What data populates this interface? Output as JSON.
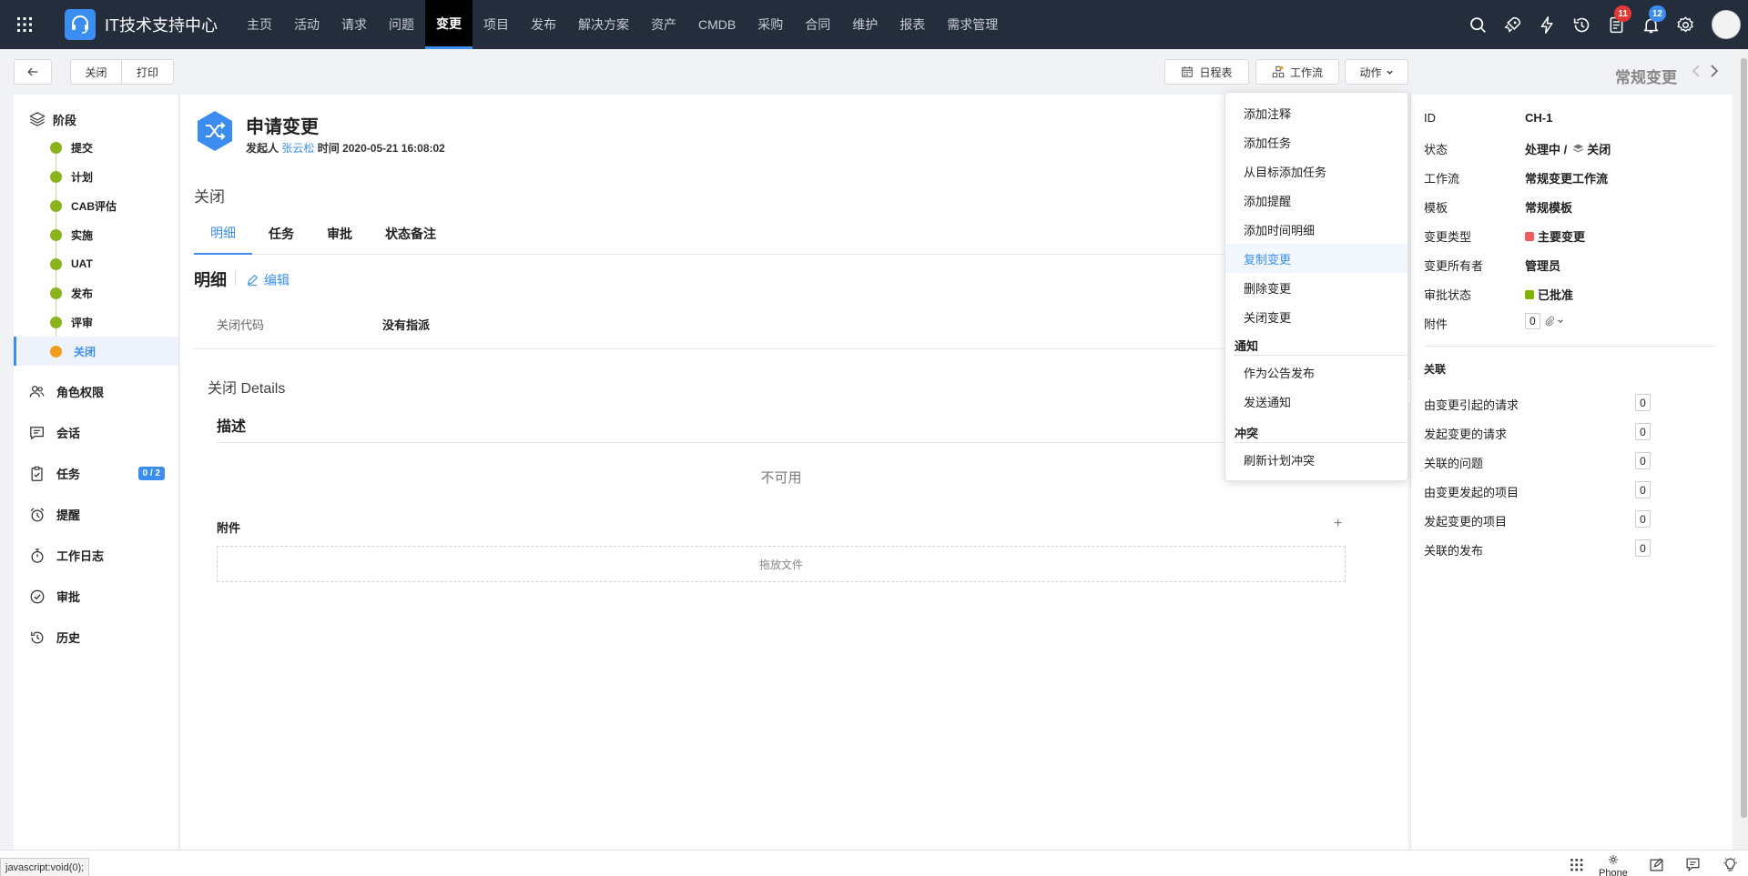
{
  "app": {
    "title": "IT技术支持中心"
  },
  "nav": {
    "items": [
      "主页",
      "活动",
      "请求",
      "问题",
      "变更",
      "项目",
      "发布",
      "解决方案",
      "资产",
      "CMDB",
      "采购",
      "合同",
      "维护",
      "报表",
      "需求管理"
    ],
    "active_index": 4,
    "badges": {
      "tasks": "11",
      "notifications": "12"
    },
    "icons": [
      "search-icon",
      "rocket-icon",
      "lightning-icon",
      "history-icon",
      "task-list-icon",
      "bell-icon",
      "gear-icon"
    ]
  },
  "toolbar": {
    "close": "关闭",
    "print": "打印",
    "schedule": "日程表",
    "workflow": "工作流",
    "actions": "动作",
    "record_type": "常规变更"
  },
  "stages": {
    "title": "阶段",
    "items": [
      "提交",
      "计划",
      "CAB评估",
      "实施",
      "UAT",
      "发布",
      "评审",
      "关闭"
    ],
    "current_index": 7,
    "colors": {
      "done": "#8bb31d",
      "current": "#f29b1d"
    }
  },
  "side_links": [
    {
      "label": "角色权限",
      "icon": "users-icon"
    },
    {
      "label": "会话",
      "icon": "chat-icon"
    },
    {
      "label": "任务",
      "icon": "clipboard-icon",
      "badge": "0 / 2"
    },
    {
      "label": "提醒",
      "icon": "alarm-clock-icon"
    },
    {
      "label": "工作日志",
      "icon": "stopwatch-icon"
    },
    {
      "label": "审批",
      "icon": "check-circle-icon"
    },
    {
      "label": "历史",
      "icon": "history-icon"
    }
  ],
  "header": {
    "title": "申请变更",
    "requester_label": "发起人",
    "requester": "张云松",
    "time_label": "时间",
    "time": "2020-05-21 16:08:02"
  },
  "status_label": "关闭",
  "tabs": [
    "明细",
    "任务",
    "审批",
    "状态备注"
  ],
  "details": {
    "title": "明细",
    "edit": "编辑",
    "field_label": "关闭代码",
    "field_value": "没有指派",
    "section_title": "关闭 Details",
    "desc_title": "描述",
    "not_available": "不可用",
    "attachments_title": "附件",
    "dropzone": "拖放文件",
    "plus": "+"
  },
  "info": {
    "id_label": "ID",
    "id_value": "CH-1",
    "status_label": "状态",
    "status_value": "处理中 /",
    "status_stage": "关闭",
    "workflow_label": "工作流",
    "workflow_value": "常规变更工作流",
    "template_label": "模板",
    "template_value": "常规模板",
    "change_type_label": "变更类型",
    "change_type_value": "主要变更",
    "change_type_color": "#f0595e",
    "owner_label": "变更所有者",
    "owner_value": "管理员",
    "approval_label": "审批状态",
    "approval_value": "已批准",
    "approval_color": "#7cb305",
    "attach_label": "附件",
    "attach_value": "0"
  },
  "related": {
    "title": "关联",
    "items": [
      {
        "label": "由变更引起的请求",
        "count": "0"
      },
      {
        "label": "发起变更的请求",
        "count": "0"
      },
      {
        "label": "关联的问题",
        "count": "0"
      },
      {
        "label": "由变更发起的项目",
        "count": "0"
      },
      {
        "label": "发起变更的项目",
        "count": "0"
      },
      {
        "label": "关联的发布",
        "count": "0"
      }
    ]
  },
  "menu": {
    "items_top": [
      "添加注释",
      "添加任务",
      "从目标添加任务",
      "添加提醒",
      "添加时间明细",
      "复制变更",
      "删除变更",
      "关闭变更"
    ],
    "highlight_index": 5,
    "group_notify": "通知",
    "items_notify": [
      "作为公告发布",
      "发送通知"
    ],
    "group_conflict": "冲突",
    "items_conflict": [
      "刷新计划冲突"
    ]
  },
  "statusbar": {
    "url": "javascript:void(0);",
    "phone": "Phone"
  }
}
